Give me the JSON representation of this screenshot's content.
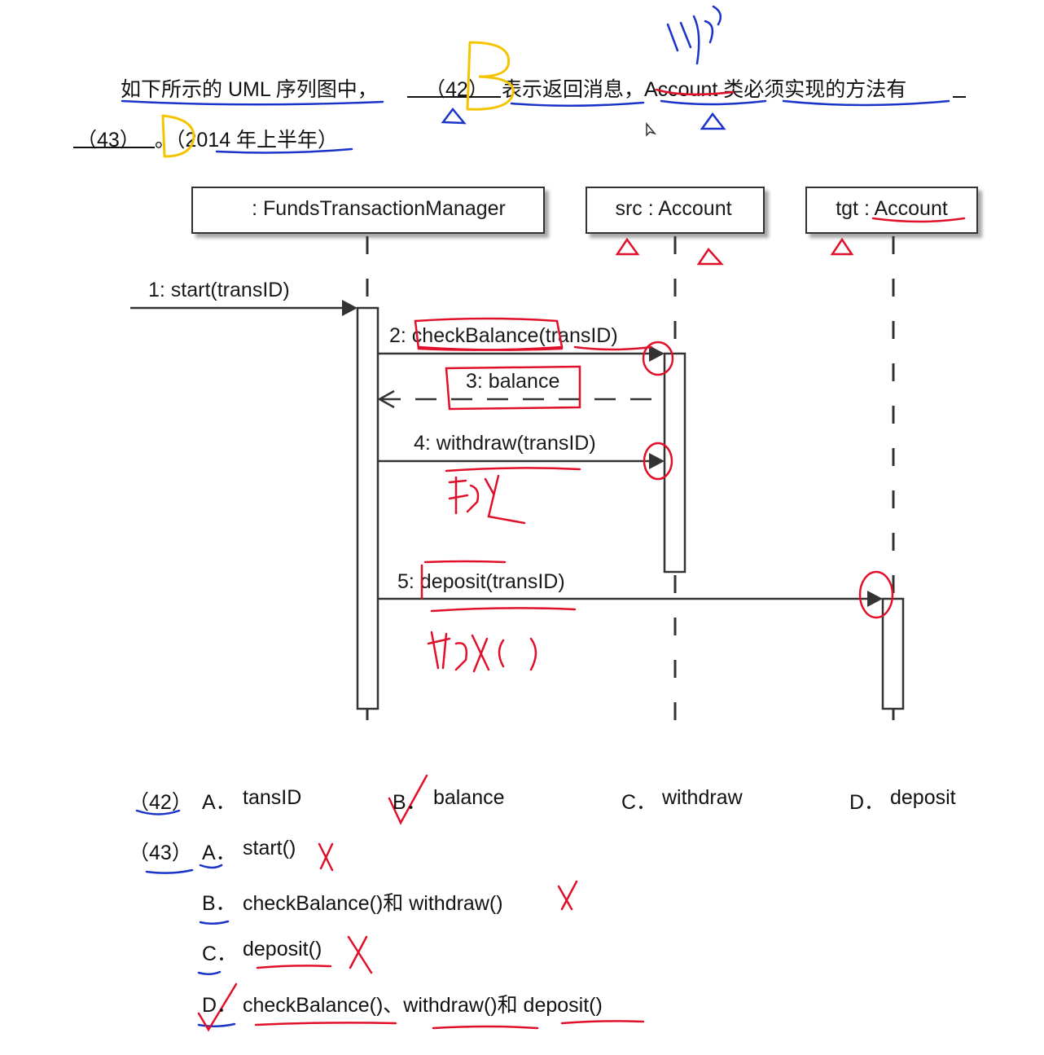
{
  "question": {
    "line1_prefix": "如下所示的 UML 序列图中，",
    "blank42": "（42）",
    "line1_middle": "表示返回消息，Account 类必须实现的方法有",
    "blank43": "（43）",
    "line2_suffix": "。（2014 年上半年）"
  },
  "diagram": {
    "lifelines": [
      {
        "label": ": FundsTransactionManager"
      },
      {
        "label": "src : Account"
      },
      {
        "label": "tgt : Account"
      }
    ],
    "messages": [
      {
        "label": "1: start(transID)",
        "kind": "call"
      },
      {
        "label": "2: checkBalance(transID)",
        "kind": "call"
      },
      {
        "label": "3: balance",
        "kind": "return"
      },
      {
        "label": "4: withdraw(transID)",
        "kind": "call"
      },
      {
        "label": "5: deposit(transID)",
        "kind": "call"
      }
    ]
  },
  "q42": {
    "number": "（42）",
    "options": [
      {
        "key": "A．",
        "text": "tansID"
      },
      {
        "key": "B．",
        "text": "balance"
      },
      {
        "key": "C．",
        "text": "withdraw"
      },
      {
        "key": "D．",
        "text": "deposit"
      }
    ]
  },
  "q43": {
    "number": "（43）",
    "options": [
      {
        "key": "A．",
        "text": "start()"
      },
      {
        "key": "B．",
        "text": "checkBalance()和 withdraw()"
      },
      {
        "key": "C．",
        "text": "deposit()"
      },
      {
        "key": "D．",
        "text": "checkBalance()、withdraw()和 deposit()"
      }
    ]
  },
  "annotations": {
    "answer42": "B",
    "answer43": "D",
    "handwritten_note_withdraw": "取钱",
    "handwritten_note_deposit": "存钱()",
    "handwritten_note_top": "账户"
  },
  "colors": {
    "ink_blue": "#1a33c8",
    "ink_red": "#e0102a",
    "ink_yellow": "#f5c400",
    "diagram_line": "#333333"
  }
}
